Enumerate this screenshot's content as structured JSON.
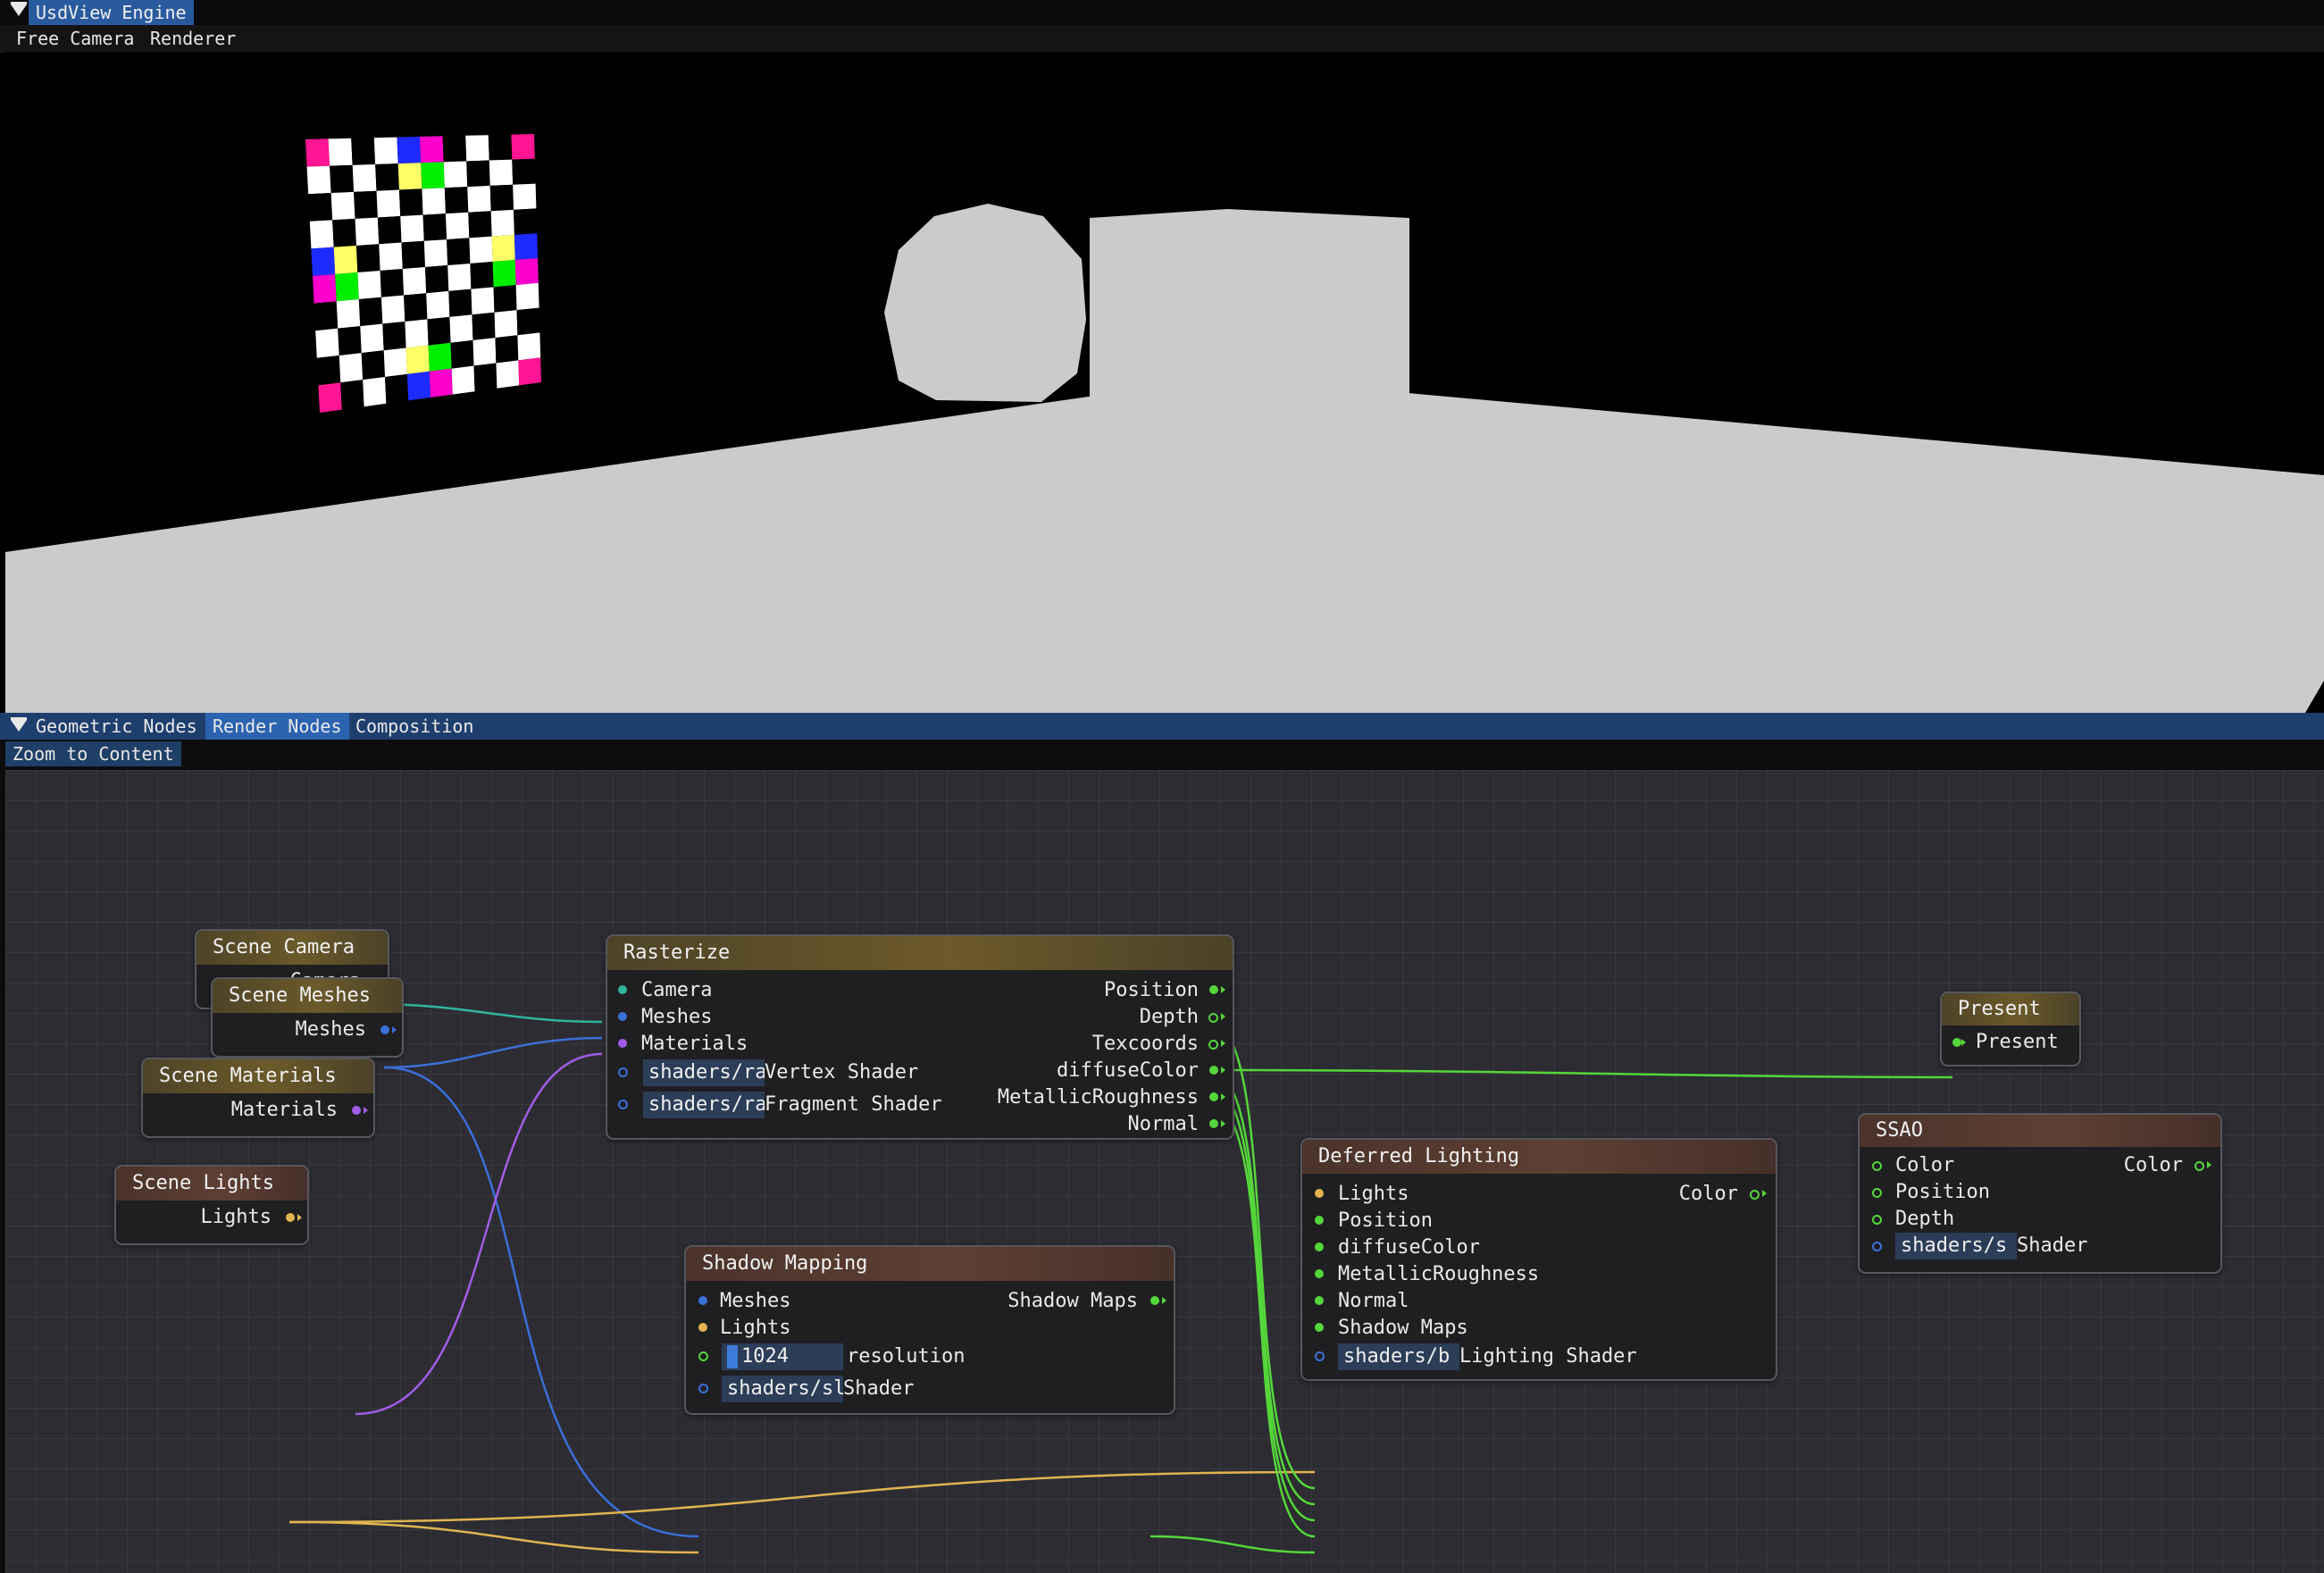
{
  "top_window": {
    "title": "UsdView Engine",
    "menu": [
      "Free Camera",
      "Renderer"
    ]
  },
  "colors": {
    "teal": "#2fb59a",
    "blue": "#3c6fd8",
    "purple": "#a05ce6",
    "gold": "#e0b450",
    "green": "#55d63a",
    "selected_tab": "#2b63b0"
  },
  "bottom_window": {
    "tabs": [
      "Geometric Nodes",
      "Render Nodes",
      "Composition"
    ],
    "active_tab": "Render Nodes",
    "toolbar": {
      "zoom_to_content": "Zoom to Content"
    }
  },
  "nodes": {
    "scene_camera": {
      "title": "Scene Camera",
      "out": "Camera"
    },
    "scene_meshes": {
      "title": "Scene Meshes",
      "out": "Meshes"
    },
    "scene_materials": {
      "title": "Scene Materials",
      "out": "Materials"
    },
    "scene_lights": {
      "title": "Scene Lights",
      "out": "Lights"
    },
    "rasterize": {
      "title": "Rasterize",
      "inputs": [
        "Camera",
        "Meshes",
        "Materials"
      ],
      "vertex_field": "shaders/ra",
      "vertex_label": "Vertex Shader",
      "fragment_field": "shaders/ra",
      "fragment_label": "Fragment Shader",
      "outputs": [
        "Position",
        "Depth",
        "Texcoords",
        "diffuseColor",
        "MetallicRoughness",
        "Normal"
      ]
    },
    "present": {
      "title": "Present",
      "in": "Present"
    },
    "deferred_lighting": {
      "title": "Deferred Lighting",
      "inputs": [
        "Lights",
        "Position",
        "diffuseColor",
        "MetallicRoughness",
        "Normal",
        "Shadow Maps"
      ],
      "output": "Color",
      "shader_field": "shaders/b",
      "shader_label": "Lighting Shader"
    },
    "ssao": {
      "title": "SSAO",
      "inputs": [
        "Color",
        "Position",
        "Depth"
      ],
      "output": "Color",
      "shader_field": "shaders/s",
      "shader_label": "Shader"
    },
    "shadow_mapping": {
      "title": "Shadow Mapping",
      "inputs": [
        "Meshes",
        "Lights"
      ],
      "output": "Shadow Maps",
      "resolution_value": "1024",
      "resolution_label": "resolution",
      "shader_field": "shaders/sl",
      "shader_label": "Shader"
    }
  }
}
